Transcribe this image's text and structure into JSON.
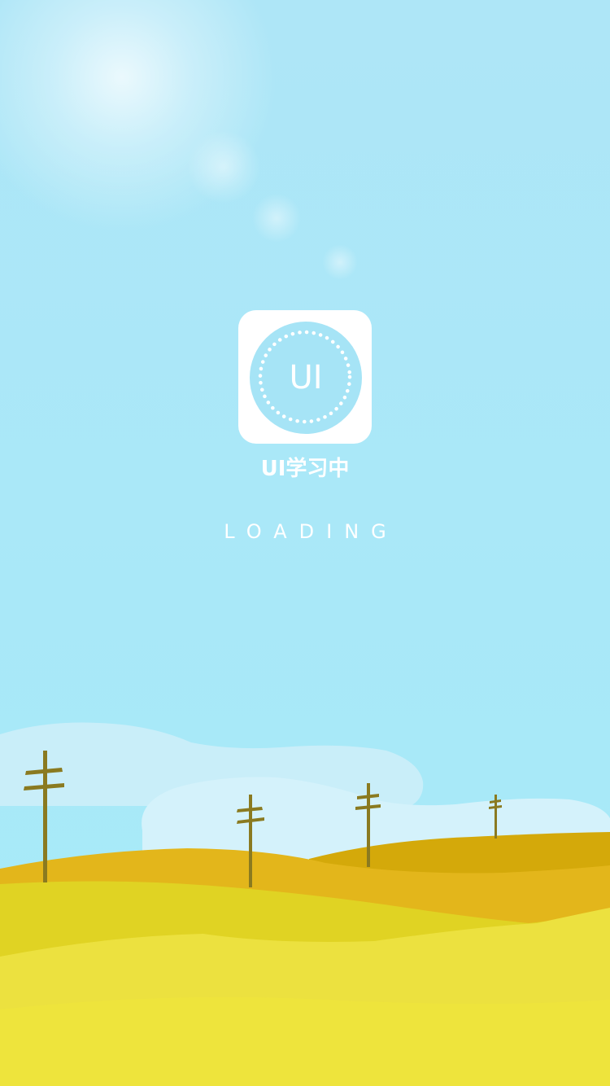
{
  "splash": {
    "app_icon": {
      "icon": "ui-logo-icon",
      "monogram": "UI",
      "background_color": "#ffffff",
      "disc_color": "#a6e4f6"
    },
    "app_name": "UI学习中",
    "loading_label": "LOADING"
  },
  "scene": {
    "sky_color": "#aae8f8",
    "cloud_color": "#d6f3fb",
    "field_colors": [
      "#d4a90a",
      "#e3b61b",
      "#e0d323",
      "#ece13f",
      "#f1e83a"
    ],
    "pole_color": "#8a7a20"
  }
}
